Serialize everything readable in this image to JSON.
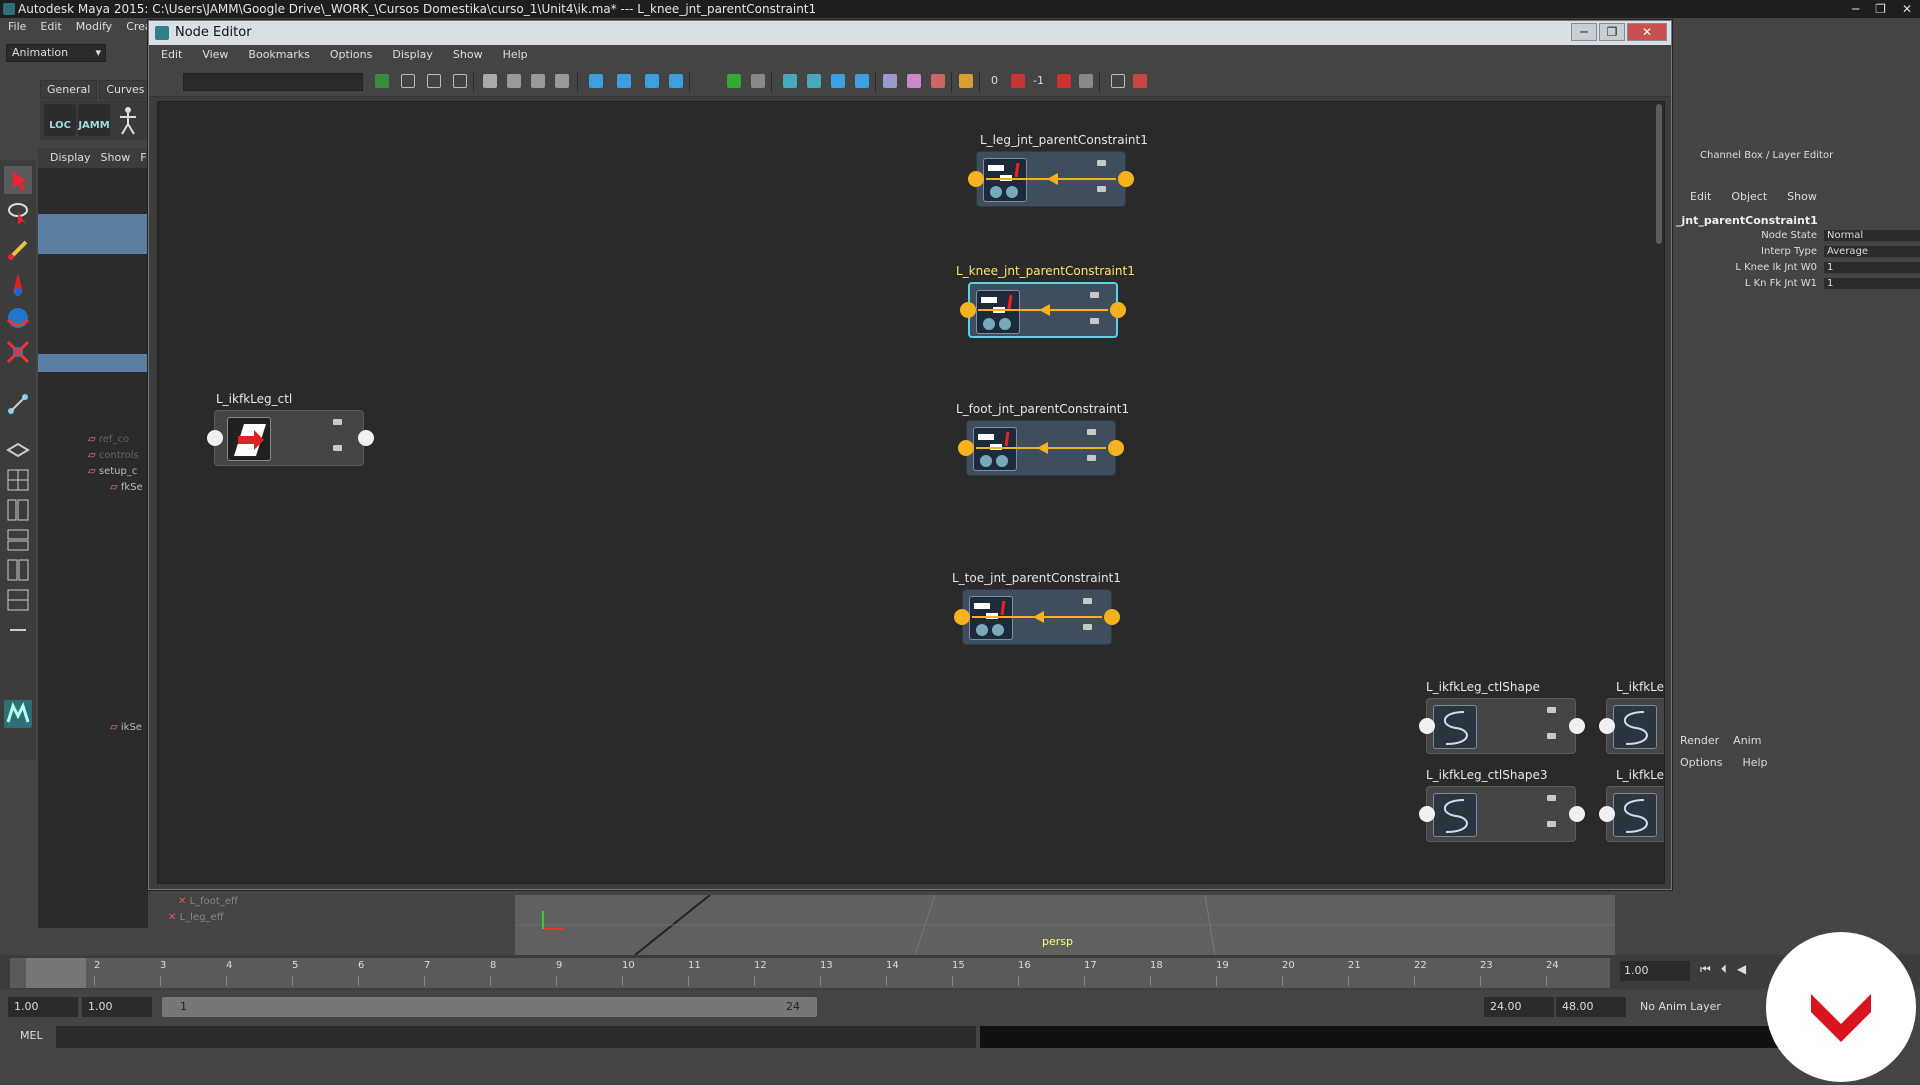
{
  "maya": {
    "title": "Autodesk Maya 2015: C:\\Users\\JAMM\\Google Drive\\_WORK_\\Cursos Domestika\\curso_1\\Unit4\\ik.ma*   ---   L_knee_jnt_parentConstraint1",
    "menu": [
      "File",
      "Edit",
      "Modify",
      "Creat"
    ],
    "mode": "Animation",
    "shelf_tabs": [
      "General",
      "Curves"
    ],
    "shelf_icons": [
      "LOC",
      "JAMM"
    ]
  },
  "outliner": {
    "menu": [
      "Display",
      "Show",
      "F"
    ],
    "rows": [
      "ref_co",
      "controls",
      "setup_c",
      "fkSe",
      "ikSe",
      "L_foot_eff",
      "L_leg_eff"
    ]
  },
  "node_editor": {
    "title": "Node Editor",
    "menu": [
      "Edit",
      "View",
      "Bookmarks",
      "Options",
      "Display",
      "Show",
      "Help"
    ],
    "toolbar_values": [
      "0",
      "-1"
    ],
    "window_controls": [
      "─",
      "❐",
      "✕"
    ],
    "nodes": {
      "leg": "L_leg_jnt_parentConstraint1",
      "knee": "L_knee_jnt_parentConstraint1",
      "foot": "L_foot_jnt_parentConstraint1",
      "toe": "L_toe_jnt_parentConstraint1",
      "ctl": "L_ikfkLeg_ctl",
      "shape": "L_ikfkLeg_ctlShape",
      "shape3": "L_ikfkLeg_ctlShape3",
      "shape_cut": "L_ikfkLe",
      "shape3_cut": "L_ikfkLe"
    }
  },
  "channel_box": {
    "title": "Channel Box / Layer Editor",
    "menu": [
      "Edit",
      "Object",
      "Show"
    ],
    "node": "_jnt_parentConstraint1",
    "attrs": [
      {
        "name": "Node State",
        "value": "Normal"
      },
      {
        "name": "Interp Type",
        "value": "Average"
      },
      {
        "name": "L Knee Ik Jnt W0",
        "value": "1"
      },
      {
        "name": "L Kn  Fk Jnt W1",
        "value": "1"
      }
    ],
    "layer_tabs": [
      "Render",
      "Anim"
    ],
    "layer_menu": [
      "Options",
      "Help"
    ]
  },
  "viewport": {
    "camera": "persp"
  },
  "timeline": {
    "frames": [
      "1",
      "2",
      "3",
      "4",
      "5",
      "6",
      "7",
      "8",
      "9",
      "10",
      "11",
      "12",
      "13",
      "14",
      "15",
      "16",
      "17",
      "18",
      "19",
      "20",
      "21",
      "22",
      "23",
      "24"
    ],
    "current_time": "1.00",
    "range_start": "1.00",
    "range_start2": "1.00",
    "slider_start": "1",
    "slider_end": "24",
    "range_end": "24.00",
    "range_end2": "48.00",
    "anim_layer": "No Anim Layer"
  },
  "command_line": {
    "label": "MEL"
  },
  "colors": {
    "port_connected": "#f5b21e",
    "port_unconnected": "#f0f0f0",
    "selection": "#5fd0e0",
    "brand": "#d8141e"
  },
  "icons": [
    "select-tool-icon",
    "lasso-tool-icon",
    "paint-tool-icon",
    "move-tool-icon",
    "rotate-tool-icon",
    "scale-tool-icon",
    "constraint-icon",
    "curve-icon",
    "control-icon",
    "brand-logo-icon"
  ]
}
